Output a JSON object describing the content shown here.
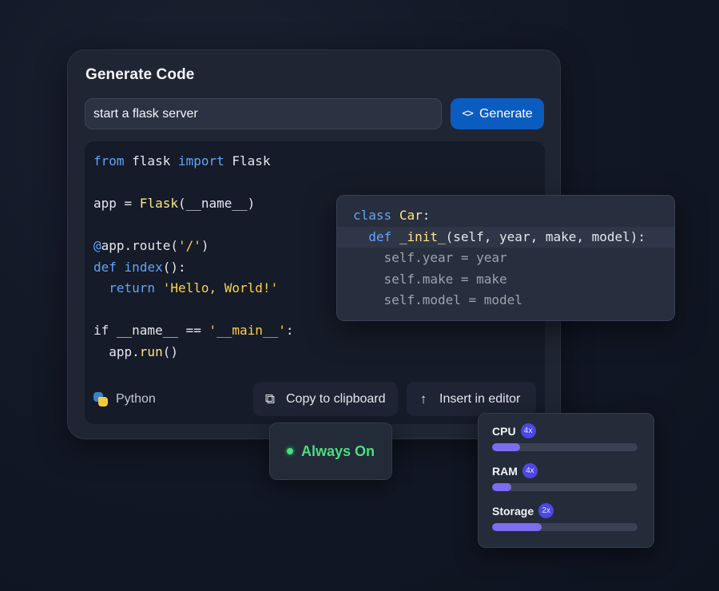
{
  "generator": {
    "title": "Generate Code",
    "prompt_value": "start a flask server",
    "generate_label": "Generate",
    "generate_icon": "code-brackets-icon",
    "code_lines": [
      [
        {
          "t": "from",
          "c": "kw"
        },
        {
          "t": " flask "
        },
        {
          "t": "import",
          "c": "kw"
        },
        {
          "t": " Flask"
        }
      ],
      [],
      [
        {
          "t": "app = "
        },
        {
          "t": "Flask",
          "c": "fn"
        },
        {
          "t": "(__name__)"
        }
      ],
      [],
      [
        {
          "t": "@",
          "c": "kw"
        },
        {
          "t": "app.route("
        },
        {
          "t": "'/'",
          "c": "str"
        },
        {
          "t": ")"
        }
      ],
      [
        {
          "t": "def",
          "c": "kw"
        },
        {
          "t": " "
        },
        {
          "t": "index",
          "c": "kw"
        },
        {
          "t": "():"
        }
      ],
      [
        {
          "t": "  "
        },
        {
          "t": "return",
          "c": "kw"
        },
        {
          "t": " "
        },
        {
          "t": "'Hello, World!'",
          "c": "str"
        }
      ],
      [],
      [
        {
          "t": "if __name__ == "
        },
        {
          "t": "'__main__'",
          "c": "str"
        },
        {
          "t": ":"
        }
      ],
      [
        {
          "t": "  app."
        },
        {
          "t": "run",
          "c": "fn"
        },
        {
          "t": "()"
        }
      ]
    ],
    "language": "Python",
    "language_icon": "python-icon",
    "copy_label": "Copy to clipboard",
    "copy_icon": "copy-icon",
    "insert_label": "Insert in editor",
    "insert_icon": "arrow-up-icon"
  },
  "class_card": {
    "lines": [
      {
        "segs": [
          {
            "t": "class",
            "c": "kw"
          },
          {
            "t": " "
          },
          {
            "t": "Car",
            "c": "fn"
          },
          {
            "t": ":"
          }
        ],
        "hl": false,
        "dim": false
      },
      {
        "segs": [
          {
            "t": "  "
          },
          {
            "t": "def",
            "c": "kw"
          },
          {
            "t": " "
          },
          {
            "t": "_init_",
            "c": "fn"
          },
          {
            "t": "(self, year, make, model):"
          }
        ],
        "hl": true,
        "dim": false
      },
      {
        "segs": [
          {
            "t": "    self.year = year"
          }
        ],
        "hl": false,
        "dim": true
      },
      {
        "segs": [
          {
            "t": "    self.make = make"
          }
        ],
        "hl": false,
        "dim": true
      },
      {
        "segs": [
          {
            "t": "    self.model = model"
          }
        ],
        "hl": false,
        "dim": true
      }
    ]
  },
  "status": {
    "label": "Always On",
    "color": "#4ade80"
  },
  "resources": [
    {
      "name": "CPU",
      "multiplier": "4x",
      "level": 0.19
    },
    {
      "name": "RAM",
      "multiplier": "4x",
      "level": 0.13
    },
    {
      "name": "Storage",
      "multiplier": "2x",
      "level": 0.34
    }
  ],
  "colors": {
    "accent": "#0b5cc1",
    "keyword": "#60a5fa",
    "string": "#fcd34d",
    "bar_fill": "#7c6cf0",
    "badge": "#4f46e5"
  }
}
